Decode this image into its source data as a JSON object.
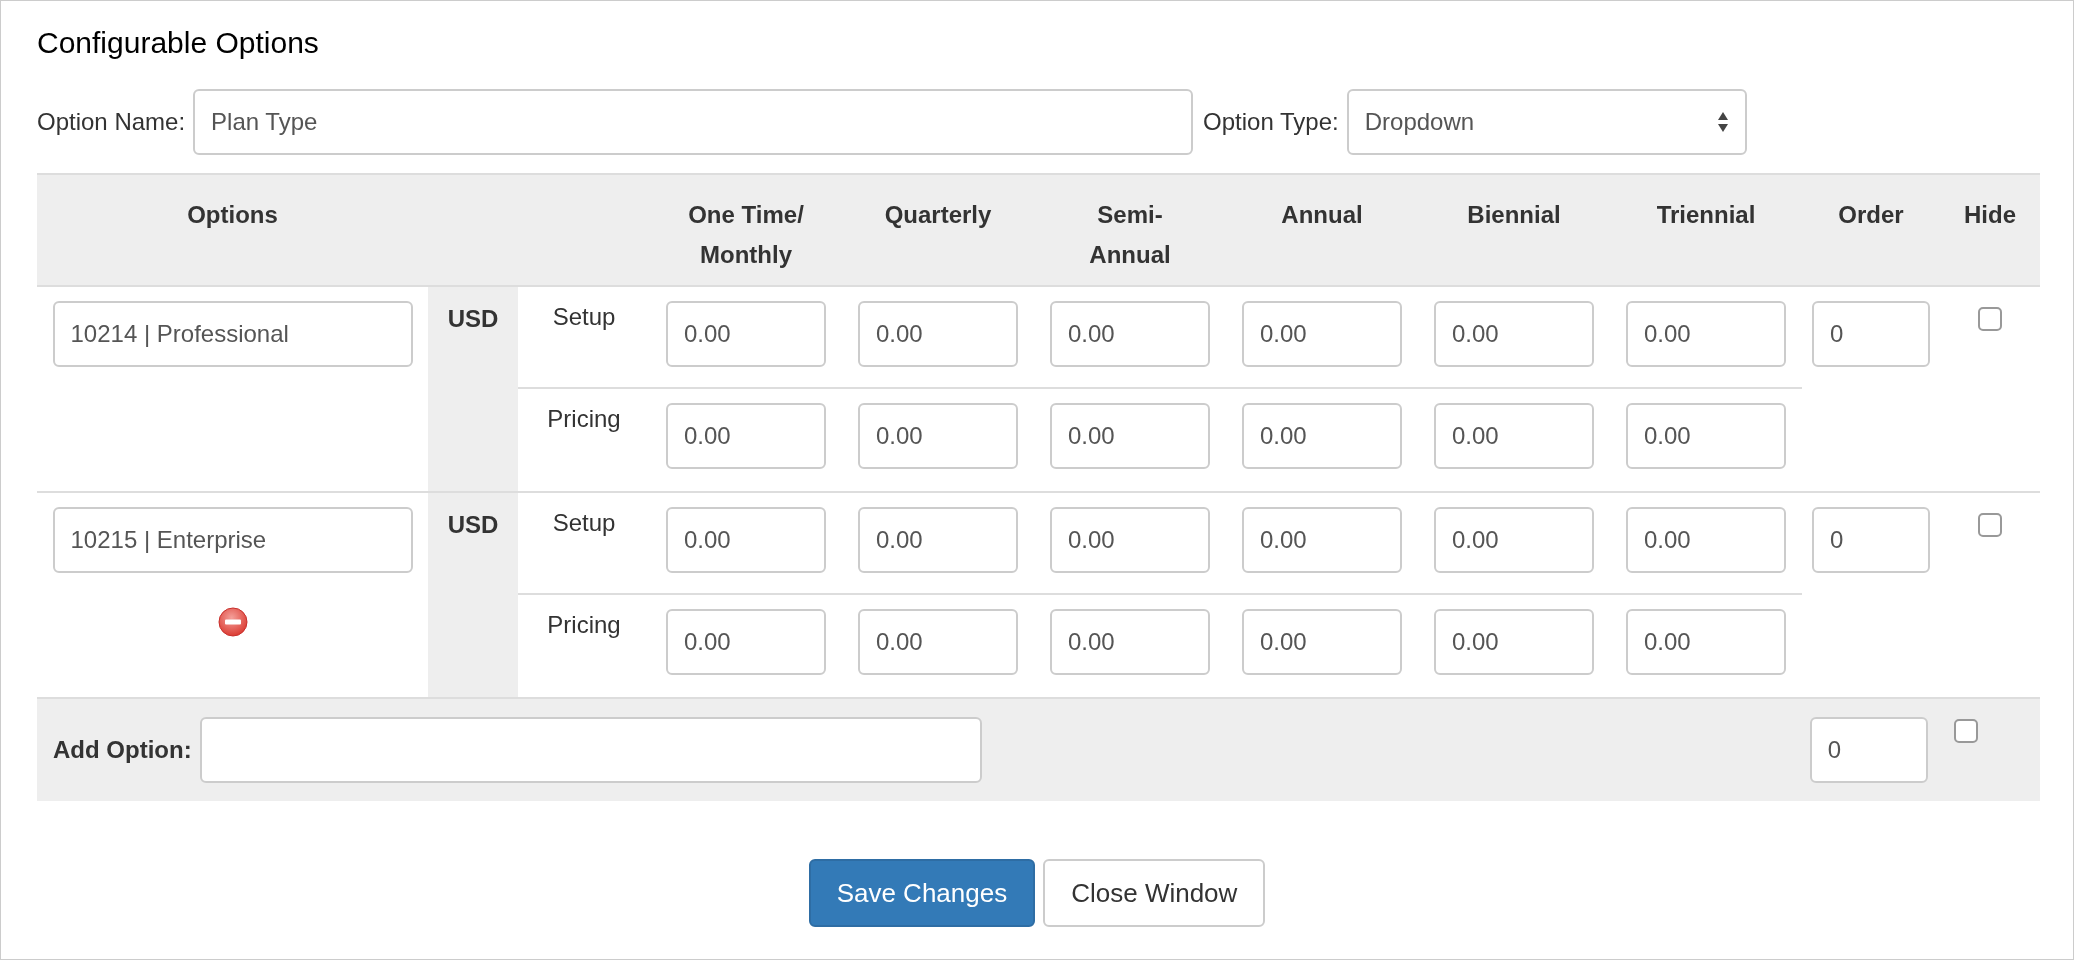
{
  "title": "Configurable Options",
  "option_name": {
    "label": "Option Name:",
    "value": "Plan Type"
  },
  "option_type": {
    "label": "Option Type:",
    "value": "Dropdown"
  },
  "table": {
    "columns": [
      {
        "label": "Options"
      },
      {
        "label": "One Time/\nMonthly"
      },
      {
        "label": "Quarterly"
      },
      {
        "label": "Semi-\nAnnual"
      },
      {
        "label": "Annual"
      },
      {
        "label": "Biennial"
      },
      {
        "label": "Triennial"
      },
      {
        "label": "Order"
      },
      {
        "label": "Hide"
      }
    ],
    "rows": [
      {
        "name": "10214 | Professional",
        "removable": false,
        "currency": "USD",
        "order": "0",
        "hide": false,
        "price_rows": [
          {
            "label": "Setup",
            "values": [
              "0.00",
              "0.00",
              "0.00",
              "0.00",
              "0.00",
              "0.00"
            ]
          },
          {
            "label": "Pricing",
            "values": [
              "0.00",
              "0.00",
              "0.00",
              "0.00",
              "0.00",
              "0.00"
            ]
          }
        ]
      },
      {
        "name": "10215 | Enterprise",
        "removable": true,
        "currency": "USD",
        "order": "0",
        "hide": false,
        "price_rows": [
          {
            "label": "Setup",
            "values": [
              "0.00",
              "0.00",
              "0.00",
              "0.00",
              "0.00",
              "0.00"
            ]
          },
          {
            "label": "Pricing",
            "values": [
              "0.00",
              "0.00",
              "0.00",
              "0.00",
              "0.00",
              "0.00"
            ]
          }
        ]
      }
    ]
  },
  "add_option": {
    "label": "Add Option:",
    "order": "0",
    "hide": false
  },
  "buttons": [
    {
      "label": "Save Changes",
      "kind": "primary"
    },
    {
      "label": "Close Window",
      "kind": "default"
    }
  ]
}
